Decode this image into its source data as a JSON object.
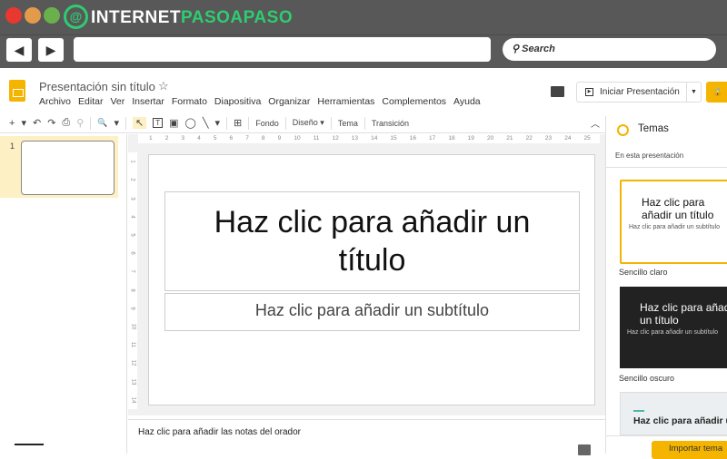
{
  "browser": {
    "logo_text_1": "INTERNET",
    "logo_text_2": "PASOAPASO",
    "back": "◀",
    "forward": "▶",
    "search_placeholder": "Search",
    "colors": {
      "red": "#e8382f",
      "orange": "#e39a4a",
      "green": "#6ab04c",
      "brand_green": "#2ecc71"
    }
  },
  "doc": {
    "title": "Presentación sin título",
    "star": "☆"
  },
  "menu": [
    "Archivo",
    "Editar",
    "Ver",
    "Insertar",
    "Formato",
    "Diapositiva",
    "Organizar",
    "Herramientas",
    "Complementos",
    "Ayuda"
  ],
  "header": {
    "present_label": "Iniciar Presentación",
    "present_icon": "▶",
    "dropdown": "▼",
    "share_icon": "🔒"
  },
  "toolbar": {
    "add": "+",
    "dropdown": "▾",
    "undo": "↶",
    "redo": "↷",
    "print": "⎙",
    "paint": "⚲",
    "zoom": "🔍",
    "select": "↖",
    "textbox": "T",
    "image": "▣",
    "shape": "◯",
    "line": "╲",
    "comment": "⊞",
    "fondo": "Fondo",
    "diseno": "Diseño ▾",
    "tema": "Tema",
    "transicion": "Transición",
    "collapse": "︿"
  },
  "filmstrip": {
    "slide_number": "1"
  },
  "ruler": {
    "h": [
      "1",
      "2",
      "3",
      "4",
      "5",
      "6",
      "7",
      "8",
      "9",
      "10",
      "11",
      "12",
      "13",
      "14",
      "15",
      "16",
      "17",
      "18",
      "19",
      "20",
      "21",
      "22",
      "23",
      "24",
      "25"
    ],
    "v": [
      "1",
      "2",
      "3",
      "4",
      "5",
      "6",
      "7",
      "8",
      "9",
      "10",
      "11",
      "12",
      "13",
      "14"
    ]
  },
  "slide": {
    "title_placeholder": "Haz clic para añadir un título",
    "subtitle_placeholder": "Haz clic para añadir un subtítulo"
  },
  "notes": {
    "placeholder": "Haz clic para añadir las notas del orador"
  },
  "themes": {
    "title": "Temas",
    "section": "En esta presentación",
    "cards": [
      {
        "name": "Sencillo claro",
        "title": "Haz clic para añadir un título",
        "subtitle": "Haz clic para añadir un subtítulo"
      },
      {
        "name": "Sencillo oscuro",
        "title": "Haz clic para añadir un título",
        "subtitle": "Haz clic para añadir un subtítulo"
      },
      {
        "title": "Haz clic para añadir un título"
      }
    ],
    "import_label": "Importar tema"
  }
}
